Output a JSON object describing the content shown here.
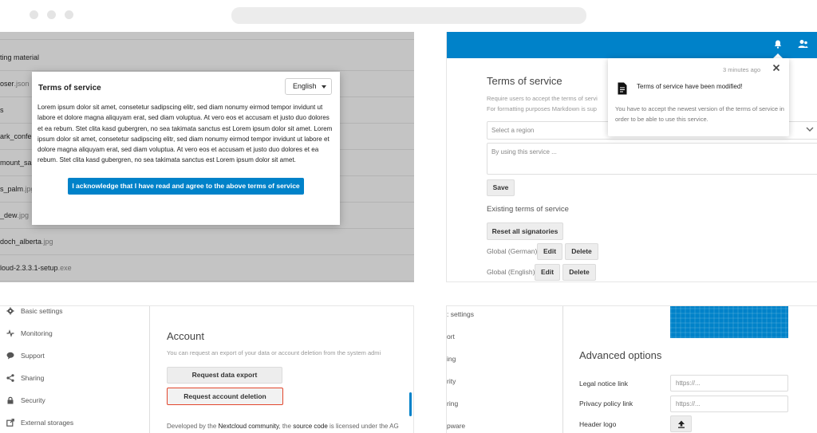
{
  "files_panel": {
    "rows": [
      {
        "name": "",
        "ext": ""
      },
      {
        "name": "ting material",
        "ext": ""
      },
      {
        "name": "oser",
        "ext": ".json"
      },
      {
        "name": "s",
        "ext": ""
      },
      {
        "name": "ark_confe",
        "ext": ""
      },
      {
        "name": "mount_sa",
        "ext": ""
      },
      {
        "name": "s_palm",
        "ext": ".jpg"
      },
      {
        "name": "_dew",
        "ext": ".jpg"
      },
      {
        "name": "doch_alberta",
        "ext": ".jpg"
      },
      {
        "name": "loud-2.3.3.1-setup",
        "ext": ".exe"
      }
    ]
  },
  "tos_modal": {
    "title": "Terms of service",
    "language": "English",
    "body": "Lorem ipsum dolor sit amet, consetetur sadipscing elitr, sed diam nonumy eirmod tempor invidunt ut labore et dolore magna aliquyam erat, sed diam voluptua. At vero eos et accusam et justo duo dolores et ea rebum. Stet clita kasd gubergren, no sea takimata sanctus est Lorem ipsum dolor sit amet. Lorem ipsum dolor sit amet, consetetur sadipscing elitr, sed diam nonumy eirmod tempor invidunt ut labore et dolore magna aliquyam erat, sed diam voluptua. At vero eos et accusam et justo duo dolores et ea rebum. Stet clita kasd gubergren, no sea takimata sanctus est Lorem ipsum dolor sit amet.",
    "accept_button": "I acknowledge that I have read and agree to the above terms of service"
  },
  "tos_admin": {
    "title": "Terms of service",
    "desc_line1": "Require users to accept the terms of servi",
    "desc_line2": "For formatting purposes Markdown is sup",
    "region_placeholder": "Select a region",
    "textarea_placeholder": "By using this service ...",
    "save_label": "Save",
    "existing_label": "Existing terms of service",
    "reset_label": "Reset all signatories",
    "entries": [
      {
        "label": "Global (German)",
        "edit": "Edit",
        "delete": "Delete"
      },
      {
        "label": "Global (English)",
        "edit": "Edit",
        "delete": "Delete"
      }
    ]
  },
  "notification": {
    "time": "3 minutes ago",
    "title": "Terms of service have been modified!",
    "body": "You have to accept the newest version of the terms of service in order to be able to use this service."
  },
  "account_panel": {
    "sidebar": [
      {
        "label": "Basic settings",
        "icon": "gear-icon"
      },
      {
        "label": "Monitoring",
        "icon": "pulse-icon"
      },
      {
        "label": "Support",
        "icon": "chat-bubble-icon"
      },
      {
        "label": "Sharing",
        "icon": "share-icon"
      },
      {
        "label": "Security",
        "icon": "lock-icon"
      },
      {
        "label": "External storages",
        "icon": "external-link-icon"
      }
    ],
    "title": "Account",
    "desc": "You can request an export of your data or account deletion from the system admi",
    "export_label": "Request data export",
    "delete_label": "Request account deletion",
    "footer_prefix": "Developed by the ",
    "footer_community": "Nextcloud community",
    "footer_mid": ", the ",
    "footer_source": "source code",
    "footer_suffix": " is licensed under the AG"
  },
  "advanced_panel": {
    "sidebar": [
      ": settings",
      "ort",
      "ing",
      "rity",
      "ring",
      "pware"
    ],
    "title": "Advanced options",
    "legal_label": "Legal notice link",
    "legal_placeholder": "https://...",
    "privacy_label": "Privacy policy link",
    "privacy_placeholder": "https://...",
    "header_logo_label": "Header logo"
  },
  "colors": {
    "primary": "#0082c9",
    "danger": "#e2462d"
  }
}
